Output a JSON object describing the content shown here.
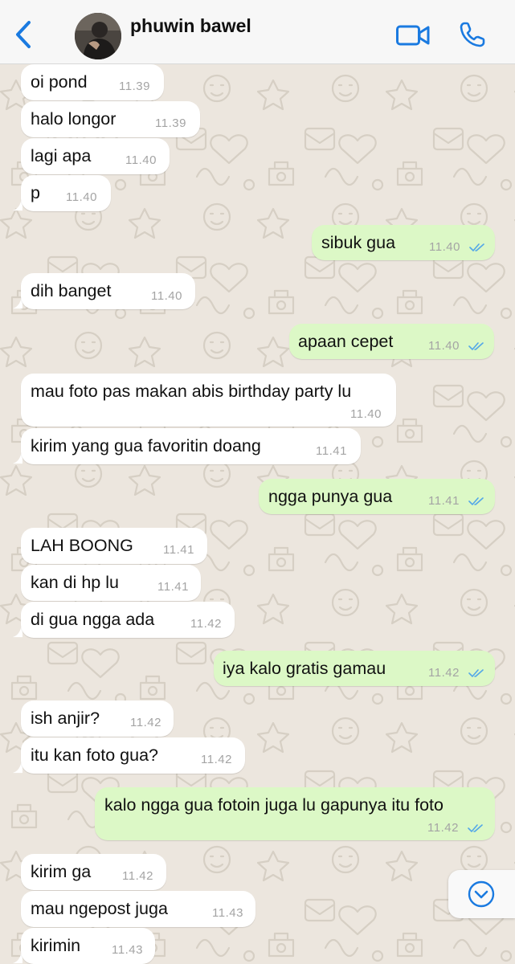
{
  "header": {
    "contact_name": "phuwin bawel",
    "back_icon": "chevron-left-icon",
    "video_icon": "video-camera-icon",
    "phone_icon": "phone-icon",
    "accent_color": "#1a7ae0"
  },
  "messages": [
    {
      "dir": "in",
      "text": "oi pond",
      "time": "11.39"
    },
    {
      "dir": "in",
      "text": "halo longor",
      "time": "11.39"
    },
    {
      "dir": "in",
      "text": "lagi apa",
      "time": "11.40"
    },
    {
      "dir": "in",
      "text": "p",
      "time": "11.40"
    },
    {
      "dir": "out",
      "text": "sibuk gua",
      "time": "11.40",
      "read": true
    },
    {
      "dir": "in",
      "text": "dih banget",
      "time": "11.40"
    },
    {
      "dir": "out",
      "text": "apaan cepet",
      "time": "11.40",
      "read": true
    },
    {
      "dir": "in",
      "text": "mau foto pas makan abis birthday party lu",
      "time": "11.40"
    },
    {
      "dir": "in",
      "text": "kirim yang gua favoritin doang",
      "time": "11.41"
    },
    {
      "dir": "out",
      "text": "ngga punya gua",
      "time": "11.41",
      "read": true
    },
    {
      "dir": "in",
      "text": "LAH BOONG",
      "time": "11.41"
    },
    {
      "dir": "in",
      "text": "kan di hp lu",
      "time": "11.41"
    },
    {
      "dir": "in",
      "text": "di gua ngga ada",
      "time": "11.42"
    },
    {
      "dir": "out",
      "text": "iya kalo gratis gamau",
      "time": "11.42",
      "read": true
    },
    {
      "dir": "in",
      "text": "ish anjir?",
      "time": "11.42"
    },
    {
      "dir": "in",
      "text": "itu kan foto gua?",
      "time": "11.42"
    },
    {
      "dir": "out",
      "text": "kalo ngga gua fotoin juga lu gapunya itu foto",
      "time": "11.42",
      "read": true
    },
    {
      "dir": "in",
      "text": "kirim ga",
      "time": "11.42"
    },
    {
      "dir": "in",
      "text": "mau ngepost juga",
      "time": "11.43"
    },
    {
      "dir": "in",
      "text": "kirimin",
      "time": "11.43"
    }
  ],
  "scroll_button": {
    "icon": "chevron-down-circle-icon"
  },
  "colors": {
    "incoming_bubble": "#ffffff",
    "outgoing_bubble": "#dcf8c6",
    "read_ticks": "#53a7e8",
    "wallpaper": "#ece6de"
  }
}
